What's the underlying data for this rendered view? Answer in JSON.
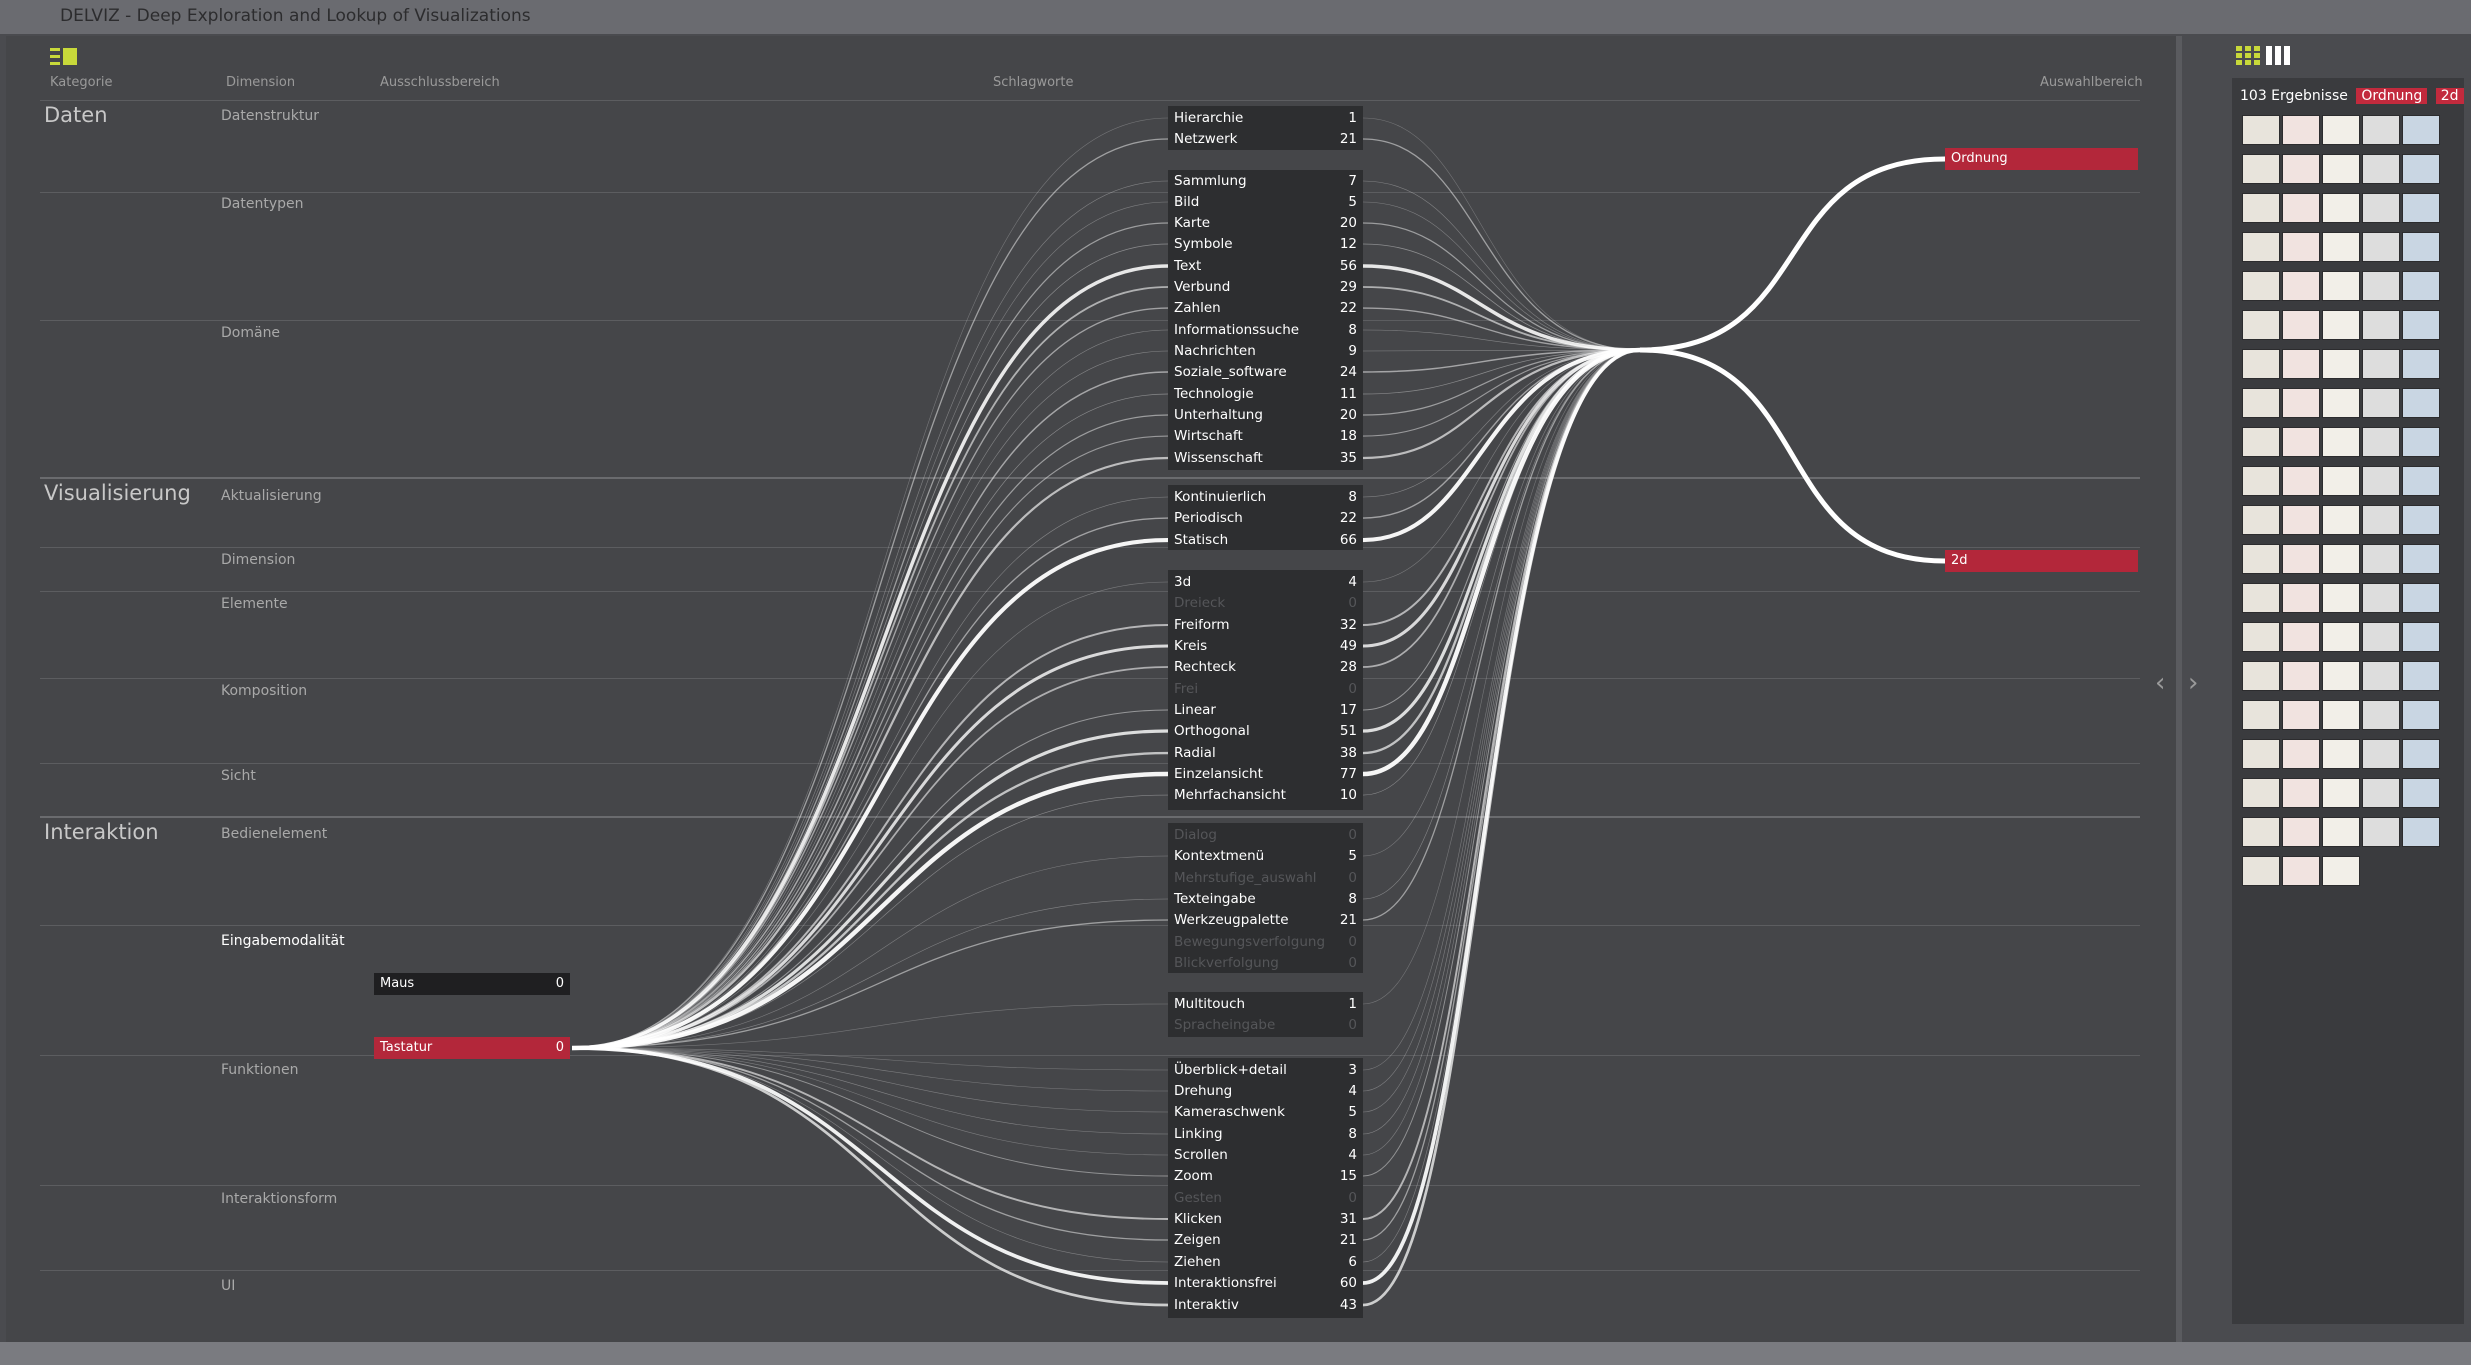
{
  "window": {
    "title": "DELVIZ - Deep Exploration and Lookup of Visualizations"
  },
  "toolbar": {
    "list_icon": "list-icon",
    "grid_icon": "grid-icon",
    "columns_icon": "columns-icon"
  },
  "headers": {
    "kategorie": "Kategorie",
    "dimension": "Dimension",
    "ausschlussbereich": "Ausschlussbereich",
    "schlagworte": "Schlagworte",
    "auswahlbereich": "Auswahlbereich"
  },
  "categories": {
    "daten": "Daten",
    "visualisierung": "Visualisierung",
    "interaktion": "Interaktion"
  },
  "dimensions": {
    "datenstruktur": "Datenstruktur",
    "datentypen": "Datentypen",
    "domaene": "Domäne",
    "aktualisierung": "Aktualisierung",
    "dimension": "Dimension",
    "elemente": "Elemente",
    "komposition": "Komposition",
    "sicht": "Sicht",
    "bedienelement": "Bedienelement",
    "eingabemodalitaet": "Eingabemodalität",
    "funktionen": "Funktionen",
    "interaktionsform": "Interaktionsform",
    "ui": "UI"
  },
  "exclusion": {
    "maus": {
      "label": "Maus",
      "count": "0"
    },
    "tastatur": {
      "label": "Tastatur",
      "count": "0"
    }
  },
  "keywords": [
    {
      "label": "Hierarchie",
      "count": "1",
      "active": true
    },
    {
      "label": "Netzwerk",
      "count": "21",
      "active": true
    },
    {
      "label": "Sammlung",
      "count": "7",
      "active": true
    },
    {
      "label": "Bild",
      "count": "5",
      "active": true
    },
    {
      "label": "Karte",
      "count": "20",
      "active": true
    },
    {
      "label": "Symbole",
      "count": "12",
      "active": true
    },
    {
      "label": "Text",
      "count": "56",
      "active": true
    },
    {
      "label": "Verbund",
      "count": "29",
      "active": true
    },
    {
      "label": "Zahlen",
      "count": "22",
      "active": true
    },
    {
      "label": "Informationssuche",
      "count": "8",
      "active": true
    },
    {
      "label": "Nachrichten",
      "count": "9",
      "active": true
    },
    {
      "label": "Soziale_software",
      "count": "24",
      "active": true
    },
    {
      "label": "Technologie",
      "count": "11",
      "active": true
    },
    {
      "label": "Unterhaltung",
      "count": "20",
      "active": true
    },
    {
      "label": "Wirtschaft",
      "count": "18",
      "active": true
    },
    {
      "label": "Wissenschaft",
      "count": "35",
      "active": true
    },
    {
      "label": "Kontinuierlich",
      "count": "8",
      "active": true
    },
    {
      "label": "Periodisch",
      "count": "22",
      "active": true
    },
    {
      "label": "Statisch",
      "count": "66",
      "active": true
    },
    {
      "label": "3d",
      "count": "4",
      "active": true
    },
    {
      "label": "Dreieck",
      "count": "0",
      "active": false
    },
    {
      "label": "Freiform",
      "count": "32",
      "active": true
    },
    {
      "label": "Kreis",
      "count": "49",
      "active": true
    },
    {
      "label": "Rechteck",
      "count": "28",
      "active": true
    },
    {
      "label": "Frei",
      "count": "0",
      "active": false
    },
    {
      "label": "Linear",
      "count": "17",
      "active": true
    },
    {
      "label": "Orthogonal",
      "count": "51",
      "active": true
    },
    {
      "label": "Radial",
      "count": "38",
      "active": true
    },
    {
      "label": "Einzelansicht",
      "count": "77",
      "active": true
    },
    {
      "label": "Mehrfachansicht",
      "count": "10",
      "active": true
    },
    {
      "label": "Dialog",
      "count": "0",
      "active": false
    },
    {
      "label": "Kontextmenü",
      "count": "5",
      "active": true
    },
    {
      "label": "Mehrstufige_auswahl",
      "count": "0",
      "active": false
    },
    {
      "label": "Texteingabe",
      "count": "8",
      "active": true
    },
    {
      "label": "Werkzeugpalette",
      "count": "21",
      "active": true
    },
    {
      "label": "Bewegungsverfolgung",
      "count": "0",
      "active": false
    },
    {
      "label": "Blickverfolgung",
      "count": "0",
      "active": false
    },
    {
      "label": "Multitouch",
      "count": "1",
      "active": true
    },
    {
      "label": "Spracheingabe",
      "count": "0",
      "active": false
    },
    {
      "label": "Überblick+detail",
      "count": "3",
      "active": true
    },
    {
      "label": "Drehung",
      "count": "4",
      "active": true
    },
    {
      "label": "Kameraschwenk",
      "count": "5",
      "active": true
    },
    {
      "label": "Linking",
      "count": "8",
      "active": true
    },
    {
      "label": "Scrollen",
      "count": "4",
      "active": true
    },
    {
      "label": "Zoom",
      "count": "15",
      "active": true
    },
    {
      "label": "Gesten",
      "count": "0",
      "active": false
    },
    {
      "label": "Klicken",
      "count": "31",
      "active": true
    },
    {
      "label": "Zeigen",
      "count": "21",
      "active": true
    },
    {
      "label": "Ziehen",
      "count": "6",
      "active": true
    },
    {
      "label": "Interaktionsfrei",
      "count": "60",
      "active": true
    },
    {
      "label": "Interaktiv",
      "count": "43",
      "active": true
    }
  ],
  "selection": {
    "ordnung": {
      "label": "Ordnung"
    },
    "zweid": {
      "label": "2d"
    }
  },
  "results": {
    "count_label": "103 Ergebnisse",
    "tags": [
      "Ordnung",
      "2d"
    ]
  },
  "colors": {
    "accent": "#b3273a",
    "background": "#454649",
    "keyword_bg": "#2d2e30"
  }
}
